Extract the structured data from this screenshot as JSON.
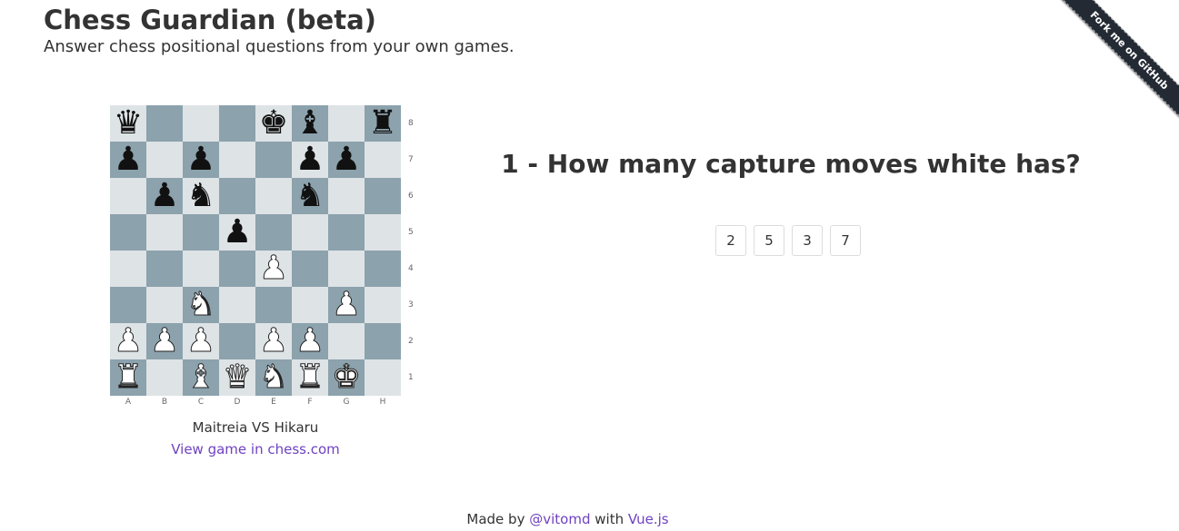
{
  "header": {
    "title": "Chess Guardian (beta)",
    "subtitle": "Answer chess positional questions from your own games."
  },
  "ribbon": {
    "label": "Fork me on GitHub"
  },
  "board": {
    "files": [
      "A",
      "B",
      "C",
      "D",
      "E",
      "F",
      "G",
      "H"
    ],
    "ranks": [
      "8",
      "7",
      "6",
      "5",
      "4",
      "3",
      "2",
      "1"
    ],
    "rows": [
      [
        "bq",
        "",
        "",
        "",
        "bk",
        "bb",
        "",
        "br"
      ],
      [
        "bp",
        "",
        "bp",
        "",
        "",
        "bp",
        "bp",
        ""
      ],
      [
        "",
        "bp",
        "bn",
        "",
        "",
        "bn",
        "",
        ""
      ],
      [
        "",
        "",
        "",
        "bp",
        "",
        "",
        "",
        ""
      ],
      [
        "",
        "",
        "",
        "",
        "wp",
        "",
        "",
        ""
      ],
      [
        "",
        "",
        "wn",
        "",
        "",
        "",
        "wp",
        ""
      ],
      [
        "wp",
        "wp",
        "wp",
        "",
        "wp",
        "wp",
        "",
        ""
      ],
      [
        "wr",
        "",
        "wb",
        "wq",
        "wn",
        "wr",
        "wk",
        ""
      ]
    ],
    "light_color": "#dee3e6",
    "dark_color": "#8ca2ad"
  },
  "game": {
    "title": "Maitreia VS Hikaru",
    "link_label": "View game in chess.com"
  },
  "question": {
    "text": "1 - How many capture moves white has?",
    "options": [
      "2",
      "5",
      "3",
      "7"
    ]
  },
  "footer": {
    "made_by": "Made by",
    "author": "@vitomd",
    "with": "with",
    "framework": "Vue.js"
  },
  "colors": {
    "link": "#6f42c1",
    "ribbon": "#242a33"
  }
}
